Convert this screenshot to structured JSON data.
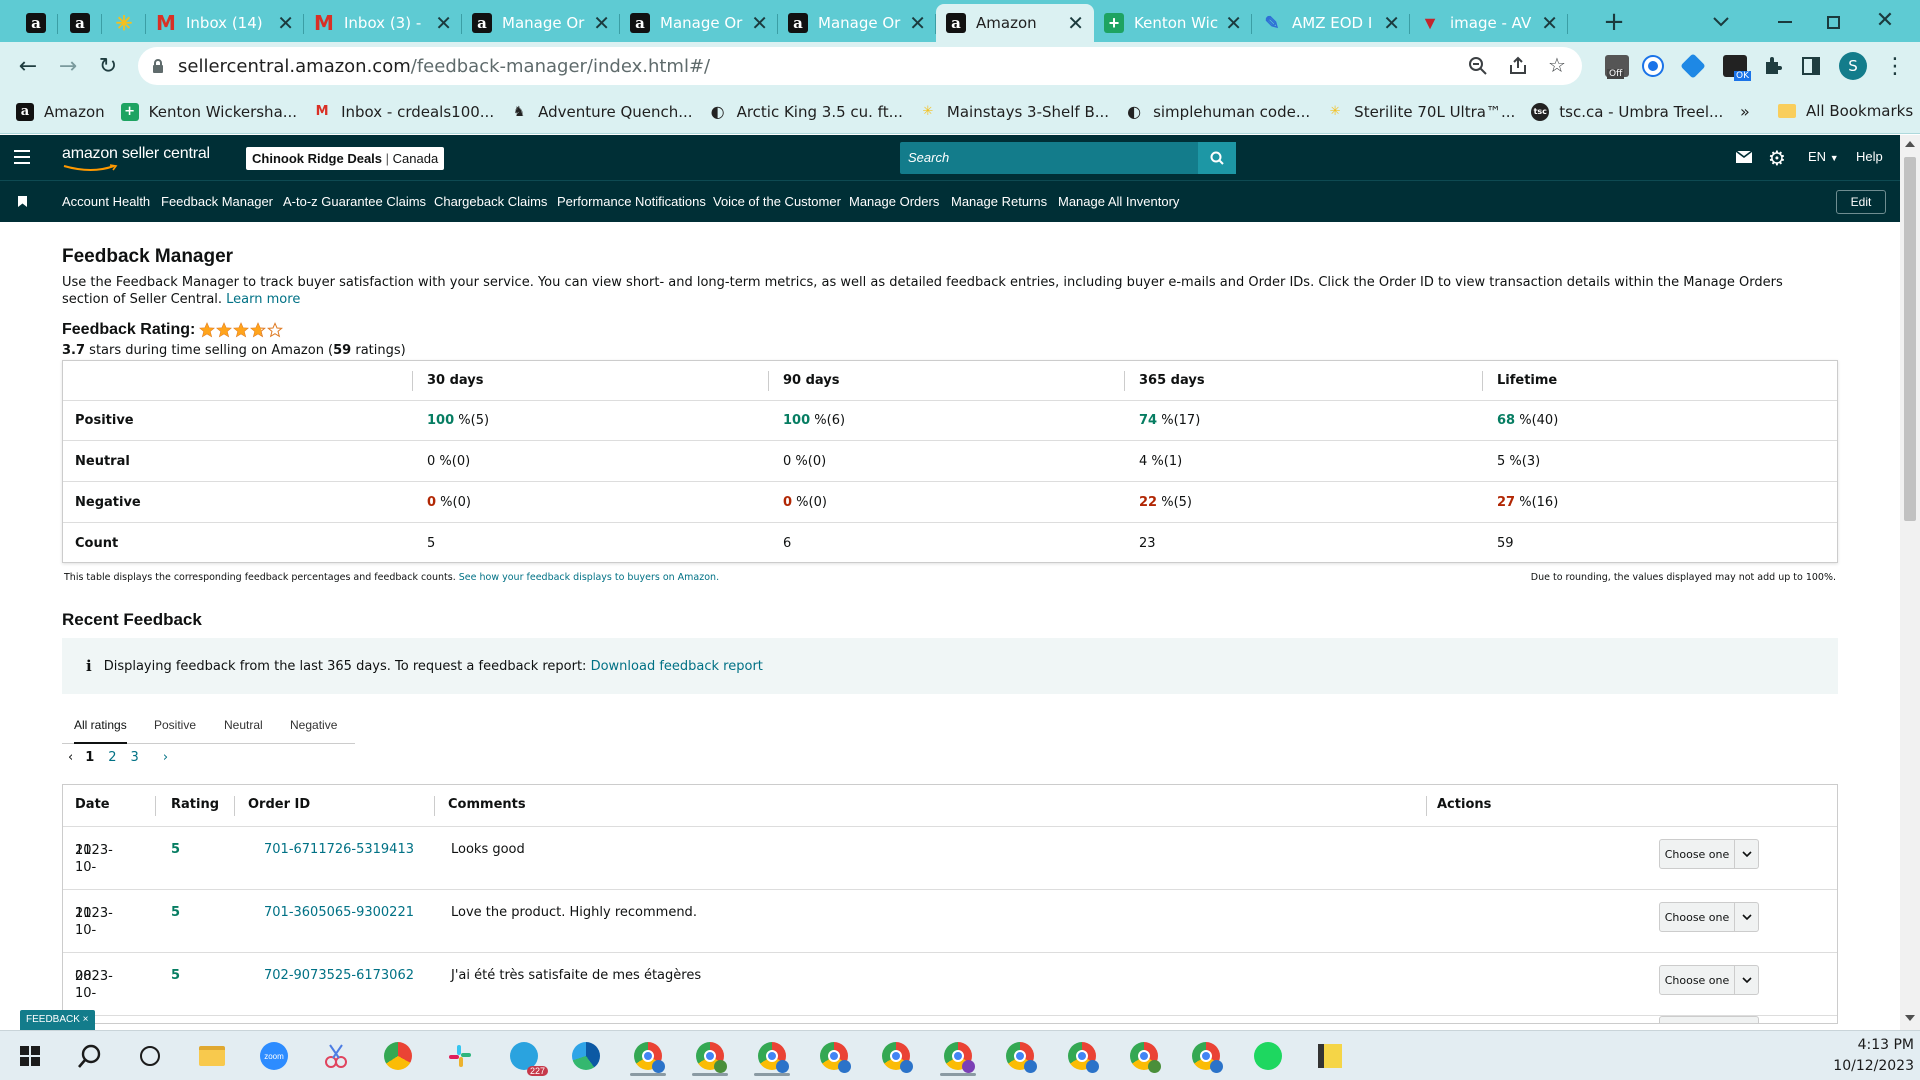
{
  "browser": {
    "tabs": [
      {
        "title": "",
        "favicon": "amazon-icon",
        "kind": "mini"
      },
      {
        "title": "",
        "favicon": "amazon-icon",
        "kind": "mini"
      },
      {
        "title": "",
        "favicon": "sunburst-icon",
        "kind": "mini"
      },
      {
        "title": "Inbox (14)",
        "favicon": "gmail-icon"
      },
      {
        "title": "Inbox (3) -",
        "favicon": "gmail-icon"
      },
      {
        "title": "Manage Or",
        "favicon": "amazon-icon"
      },
      {
        "title": "Manage Or",
        "favicon": "amazon-icon"
      },
      {
        "title": "Manage Or",
        "favicon": "amazon-icon"
      },
      {
        "title": "Amazon",
        "favicon": "amazon-icon",
        "active": true
      },
      {
        "title": "Kenton Wic",
        "favicon": "sheets-icon"
      },
      {
        "title": "AMZ EOD I",
        "favicon": "pencil-icon"
      },
      {
        "title": "image - AV",
        "favicon": "v-icon"
      }
    ],
    "url_host": "sellercentral.amazon.com",
    "url_path": "/feedback-manager/index.html#/",
    "bookmarks": [
      {
        "label": "Amazon",
        "icon": "amazon-icon"
      },
      {
        "label": "Kenton Wickersha...",
        "icon": "sheets-icon"
      },
      {
        "label": "Inbox - crdeals100...",
        "icon": "gmail-icon"
      },
      {
        "label": "Adventure Quench...",
        "icon": "moose-icon"
      },
      {
        "label": "Arctic King 3.5 cu. ft...",
        "icon": "globe-icon"
      },
      {
        "label": "Mainstays 3-Shelf B...",
        "icon": "walmart-icon"
      },
      {
        "label": "simplehuman code...",
        "icon": "globe-icon"
      },
      {
        "label": "Sterilite 70L Ultra™...",
        "icon": "walmart-icon"
      },
      {
        "label": "tsc.ca - Umbra Treel...",
        "icon": "tsc-icon"
      }
    ],
    "bookmarks_more": "»",
    "all_bookmarks": "All Bookmarks",
    "profile_initial": "S",
    "ext_badge_off": "Off",
    "ext_badge_ok": "OK"
  },
  "header": {
    "logo": "amazon seller central",
    "store_name": "Chinook Ridge Deals",
    "store_region": "Canada",
    "search_placeholder": "Search",
    "lang": "EN",
    "help": "Help"
  },
  "nav": {
    "items": [
      "Account Health",
      "Feedback Manager",
      "A-to-z Guarantee Claims",
      "Chargeback Claims",
      "Performance Notifications",
      "Voice of the Customer",
      "Manage Orders",
      "Manage Returns",
      "Manage All Inventory"
    ],
    "edit": "Edit"
  },
  "page": {
    "title": "Feedback Manager",
    "description": "Use the Feedback Manager to track buyer satisfaction with your service. You can view short- and long-term metrics, as well as detailed feedback entries, including buyer e-mails and Order IDs. Click the Order ID to view transaction details within the Manage Orders section of Seller Central.",
    "learn_more": "Learn more",
    "rating_label": "Feedback Rating:",
    "rating_stars": 3.7,
    "rating_value": "3.7",
    "rating_text_mid": "stars during time selling on Amazon (",
    "rating_count": "59",
    "rating_text_end": "ratings)",
    "metrics": {
      "periods": [
        "30 days",
        "90 days",
        "365 days",
        "Lifetime"
      ],
      "rows": [
        {
          "label": "Positive",
          "kind": "pos",
          "cells": [
            [
              "100",
              " %(5)"
            ],
            [
              "100",
              " %(6)"
            ],
            [
              "74",
              " %(17)"
            ],
            [
              "68",
              " %(40)"
            ]
          ]
        },
        {
          "label": "Neutral",
          "kind": "neu",
          "cells": [
            [
              "0",
              " %(0)"
            ],
            [
              "0",
              " %(0)"
            ],
            [
              "4",
              " %(1)"
            ],
            [
              "5",
              " %(3)"
            ]
          ]
        },
        {
          "label": "Negative",
          "kind": "neg",
          "cells": [
            [
              "0",
              " %(0)"
            ],
            [
              "0",
              " %(0)"
            ],
            [
              "22",
              " %(5)"
            ],
            [
              "27",
              " %(16)"
            ]
          ]
        },
        {
          "label": "Count",
          "kind": "cnt",
          "cells": [
            [
              "5",
              ""
            ],
            [
              "6",
              ""
            ],
            [
              "23",
              ""
            ],
            [
              "59",
              ""
            ]
          ]
        }
      ]
    },
    "footnote": "This table displays the corresponding feedback percentages and feedback counts.",
    "footnote_link": "See how your feedback displays to buyers on Amazon.",
    "rounding_note": "Due to rounding, the values displayed may not add up to 100%.",
    "recent_title": "Recent Feedback",
    "info_text": "Displaying feedback from the last 365 days. To request a feedback report:",
    "info_link": "Download feedback report",
    "filter_tabs": [
      "All ratings",
      "Positive",
      "Neutral",
      "Negative"
    ],
    "pages": [
      "1",
      "2",
      "3"
    ],
    "feedback_table": {
      "headers": [
        "Date",
        "Rating",
        "Order ID",
        "Comments",
        "Actions"
      ],
      "rows": [
        {
          "date1": "2023-10-",
          "date2": "11",
          "rating": "5",
          "order_id": "701-6711726-5319413",
          "comment": "Looks good",
          "action": "Choose one"
        },
        {
          "date1": "2023-10-",
          "date2": "11",
          "rating": "5",
          "order_id": "701-3605065-9300221",
          "comment": "Love the product. Highly recommend.",
          "action": "Choose one"
        },
        {
          "date1": "2023-10-",
          "date2": "08",
          "rating": "5",
          "order_id": "702-9073525-6173062",
          "comment": "J'ai été très satisfaite de mes étagères",
          "action": "Choose one"
        }
      ]
    },
    "feedback_badge": "FEEDBACK ×"
  },
  "taskbar": {
    "time": "4:13 PM",
    "date": "10/12/2023",
    "telegram_badge": "227",
    "zoom_label": "zoom"
  },
  "colors": {
    "tabstrip": "#5ecbd3",
    "toolbar": "#dbf1f2",
    "amazon_header": "#002f36",
    "search_bg": "#137c8b",
    "positive": "#067d62",
    "negative": "#b12704",
    "link": "#007185",
    "star": "#ffa41c"
  }
}
